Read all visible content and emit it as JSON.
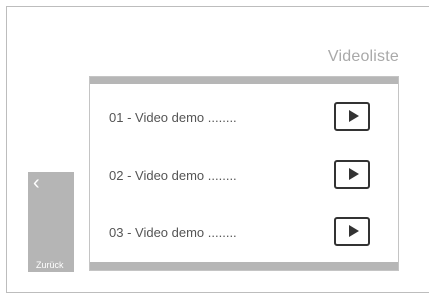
{
  "header": {
    "title": "Videoliste"
  },
  "videos": [
    {
      "label": "01  -  Video demo ........",
      "play_icon": "play-icon"
    },
    {
      "label": "02  -  Video demo ........",
      "play_icon": "play-icon"
    },
    {
      "label": "03  -  Video demo ........",
      "play_icon": "play-icon"
    }
  ],
  "back_button": {
    "icon": "chevron-left-icon",
    "glyph": "‹",
    "label": "Zurück"
  },
  "colors": {
    "panel_bar": "#b6b6b6",
    "title": "#a9a9a9",
    "back_bg": "#b5b5b5"
  }
}
